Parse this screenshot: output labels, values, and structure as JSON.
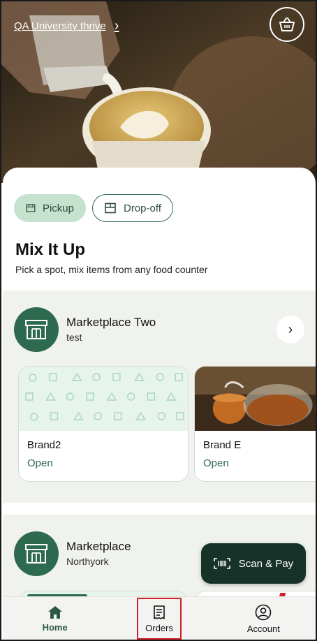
{
  "header": {
    "site_name": "QA University thrive",
    "chevron": "›",
    "basket_icon": "basket-icon"
  },
  "fulfillment": {
    "pickup_label": "Pickup",
    "dropoff_label": "Drop-off",
    "selected": "Pickup"
  },
  "intro": {
    "title": "Mix It Up",
    "subtitle": "Pick a spot, mix items from any food counter"
  },
  "marketplaces": [
    {
      "name": "Marketplace Two",
      "subtitle": "test",
      "brands": [
        {
          "name": "Brand2",
          "status": "Open"
        },
        {
          "name": "Brand E",
          "status": "Open"
        }
      ]
    },
    {
      "name": "Marketplace",
      "subtitle": "Northyork"
    }
  ],
  "scan_pay": {
    "label": "Scan & Pay"
  },
  "nav": {
    "home": "Home",
    "orders": "Orders",
    "account": "Account"
  },
  "colors": {
    "brand_green": "#2d6a4f",
    "chip_active": "#c5e2cf",
    "dark_button": "#173329",
    "open_status": "#2f6b52"
  }
}
